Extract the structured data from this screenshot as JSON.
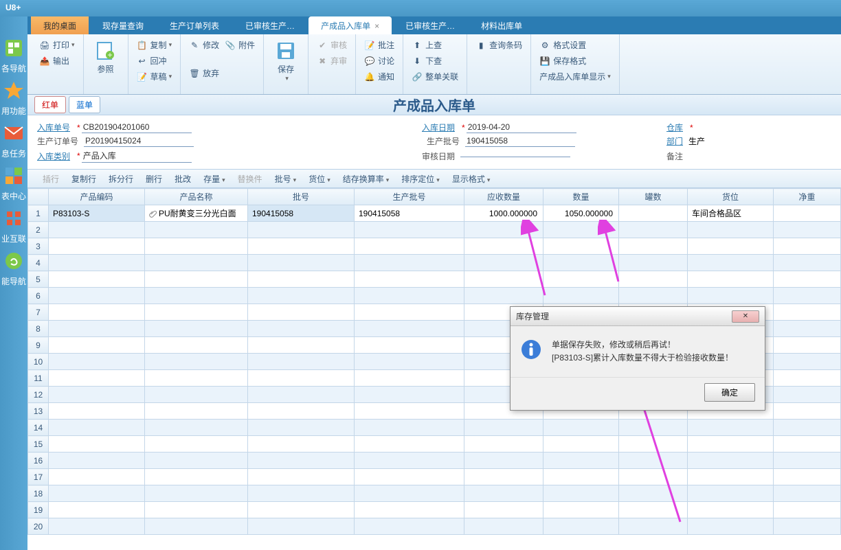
{
  "app": {
    "title": "U8+"
  },
  "tabs": [
    {
      "label": "我的桌面",
      "cls": "inactive"
    },
    {
      "label": "现存量查询",
      "cls": ""
    },
    {
      "label": "生产订单列表",
      "cls": ""
    },
    {
      "label": "已审核生产…",
      "cls": ""
    },
    {
      "label": "产成品入库单",
      "cls": "active",
      "close": true
    },
    {
      "label": "已审核生产…",
      "cls": ""
    },
    {
      "label": "材料出库单",
      "cls": ""
    }
  ],
  "ribbon": {
    "print": "打印",
    "output": "输出",
    "ref": "参照",
    "copy": "复制",
    "undo": "回冲",
    "draft": "草稿",
    "modify": "修改",
    "attach": "附件",
    "discard": "放弃",
    "save": "保存",
    "audit": "审核",
    "abandon": "弃审",
    "approve": "批注",
    "chat": "讨论",
    "notify": "通知",
    "up": "上查",
    "down": "下查",
    "link": "整单关联",
    "barcode": "查询条码",
    "format": "格式设置",
    "savefmt": "保存格式",
    "display": "产成品入库单显示"
  },
  "side": [
    "各导航",
    "用功能",
    "息任务",
    "表中心",
    "业互联",
    "能导航"
  ],
  "sub": {
    "red": "红单",
    "blue": "蓝单",
    "title": "产成品入库单"
  },
  "form": {
    "f1l": "入库单号",
    "f1v": "CB201904201060",
    "f2l": "生产订单号",
    "f2v": "P20190415024",
    "f3l": "入库类别",
    "f3v": "产品入库",
    "f4l": "入库日期",
    "f4v": "2019-04-20",
    "f5l": "生产批号",
    "f5v": "190415058",
    "f6l": "审核日期",
    "f6v": "",
    "f7l": "仓库",
    "f8l": "部门",
    "f8v": "生产",
    "f9l": "备注"
  },
  "gtb": [
    "插行",
    "复制行",
    "拆分行",
    "删行",
    "批改",
    "存量",
    "替换件",
    "批号",
    "货位",
    "结存换算率",
    "排序定位",
    "显示格式"
  ],
  "cols": [
    "产品编码",
    "产品名称",
    "批号",
    "生产批号",
    "应收数量",
    "数量",
    "罐数",
    "货位",
    "净重"
  ],
  "row": {
    "code": "P83103-S",
    "name": "PU耐黄变三分光白面",
    "lot": "190415058",
    "plot": "190415058",
    "qty1": "1000.000000",
    "qty2": "1050.000000",
    "cans": "",
    "loc": "车间合格品区",
    "wt": ""
  },
  "dlg": {
    "title": "库存管理",
    "l1": "单据保存失败，修改或稍后再试！",
    "l2": "[P83103-S]累计入库数量不得大于检验接收数量！",
    "ok": "确定"
  }
}
